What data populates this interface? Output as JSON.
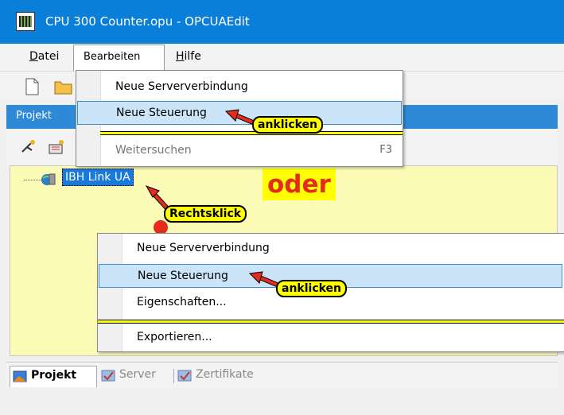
{
  "window": {
    "title": "CPU 300 Counter.opu - OPCUAEdit"
  },
  "menubar": {
    "datei": "Datei",
    "bearbeiten": "Bearbeiten",
    "hilfe": "Hilfe"
  },
  "project_header": "Projekt",
  "tree": {
    "node_label": "IBH Link UA"
  },
  "annotations": {
    "oder": "oder",
    "rechtsklick": "Rechtsklick",
    "anklicken": "anklicken"
  },
  "edit_menu": {
    "items": [
      {
        "label": "Neue Serververbindung"
      },
      {
        "label": "Neue Steuerung"
      },
      {
        "label": "Weitersuchen",
        "shortcut": "F3"
      }
    ]
  },
  "context_menu": {
    "items": [
      {
        "label": "Neue Serververbindung"
      },
      {
        "label": "Neue Steuerung"
      },
      {
        "label": "Eigenschaften..."
      },
      {
        "label": "Exportieren..."
      }
    ]
  },
  "tabs": [
    {
      "label": "Projekt"
    },
    {
      "label": "Server"
    },
    {
      "label": "Zertifikate"
    }
  ],
  "colors": {
    "titlebar": "#0a7fd9",
    "highlight": "#ffff00",
    "arrow_red": "#e52b1c",
    "tree_bg": "#fbfbb6"
  }
}
